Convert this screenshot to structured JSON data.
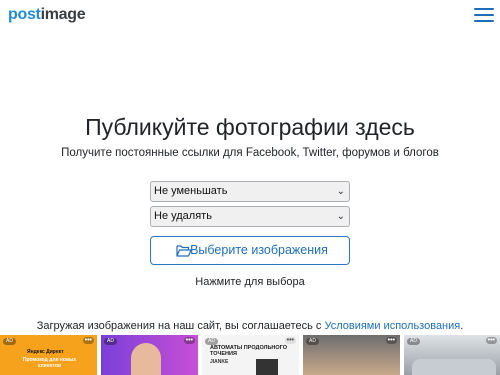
{
  "header": {
    "logo_part1": "post",
    "logo_part2": "image",
    "menu_icon": "hamburger-menu-icon"
  },
  "main": {
    "title": "Публикуйте фотографии здесь",
    "subtitle": "Получите постоянные ссылки для Facebook, Twitter, форумов и блогов",
    "resize_select": "Не уменьшать",
    "expire_select": "Не удалять",
    "choose_button": "Выберите изображения",
    "choose_icon": "folder-open-icon",
    "hint": "Нажмите для выбора",
    "terms_prefix": "Загружая изображения на наш сайт, вы соглашаетесь с ",
    "terms_link": "Условиями использования",
    "terms_suffix": "."
  },
  "ads": {
    "badge": "AD",
    "dots": "•••",
    "ad1_line1": "Яндекс Директ",
    "ad1_line2": "Промокод для новых клиентов",
    "ad3_line1": "АВТОМАТЫ ПРОДОЛЬНОГО ТОЧЕНИЯ",
    "ad3_brand": "JIANKE"
  },
  "colors": {
    "accent": "#1f6fb8",
    "logo_blue": "#1f8dd6"
  }
}
